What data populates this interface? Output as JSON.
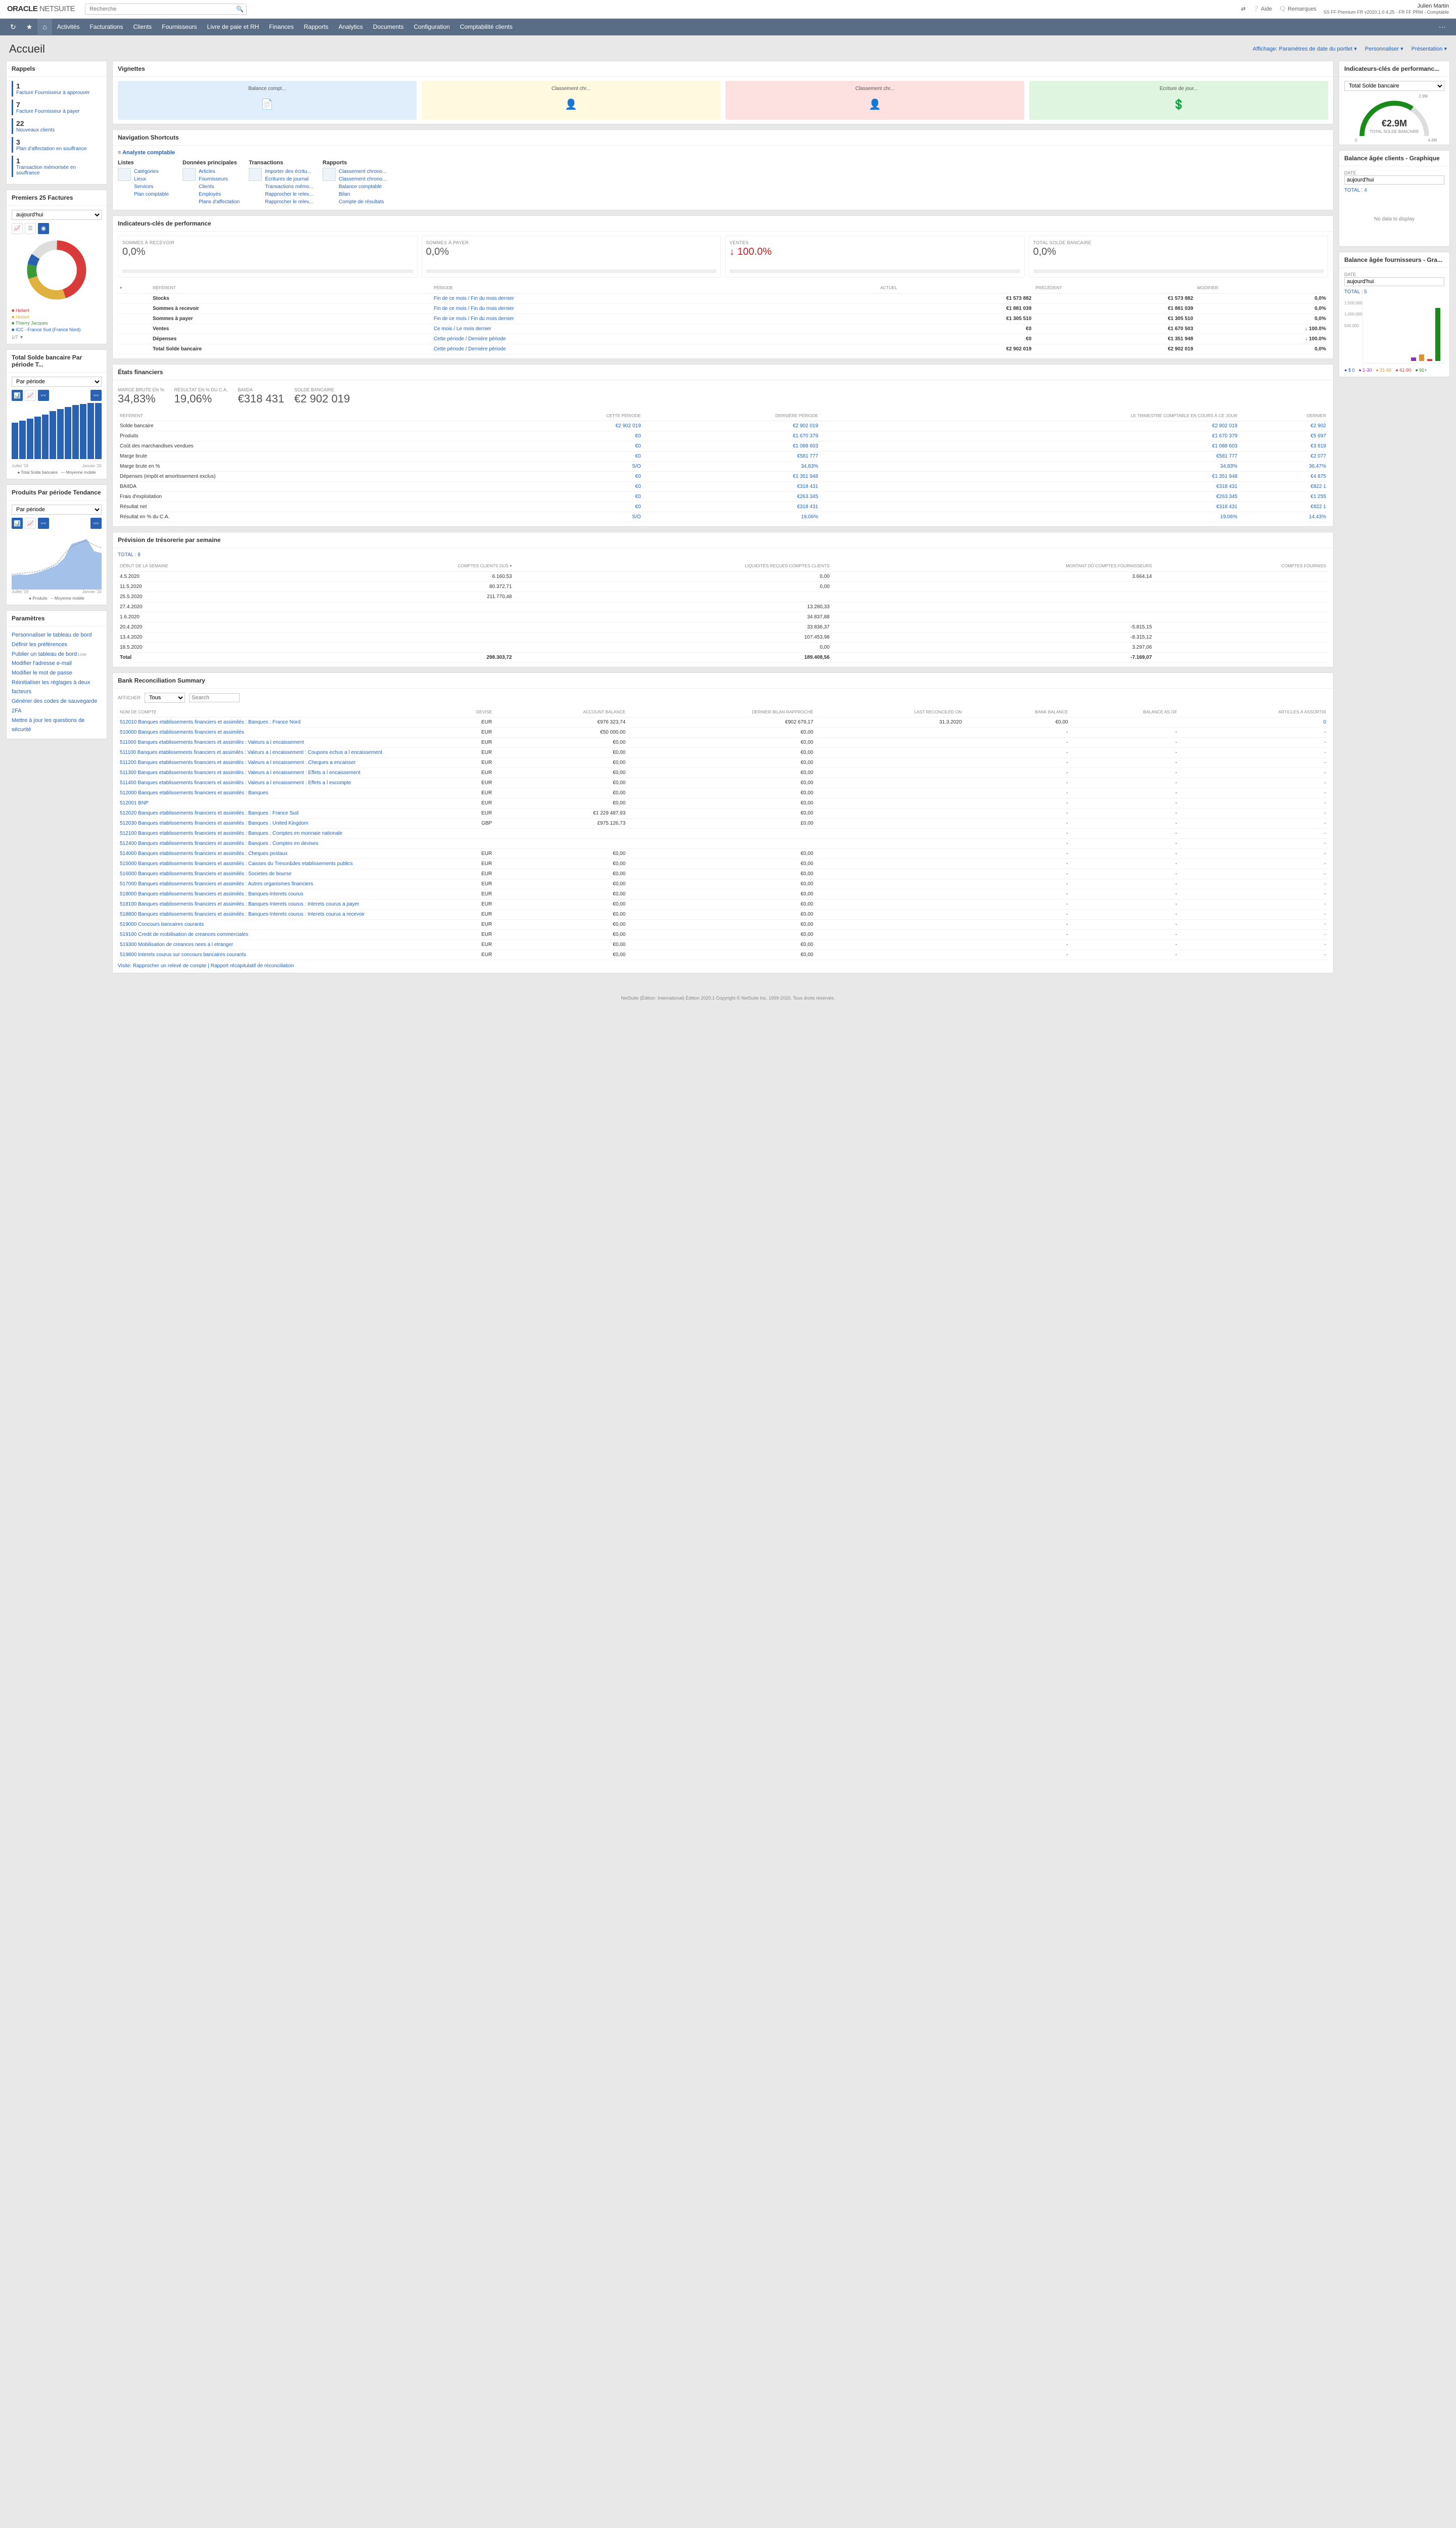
{
  "header": {
    "brand_a": "ORACLE",
    "brand_b": "NETSUITE",
    "search_placeholder": "Recherche",
    "help": "Aide",
    "remarks": "Remarques",
    "user_name": "Julien Martin",
    "user_sub": "SS FF Premium FR v2020.1.0 4.25 - FR FF PRM - Comptable"
  },
  "nav": [
    "Activités",
    "Facturations",
    "Clients",
    "Fournisseurs",
    "Livre de paie et RH",
    "Finances",
    "Rapports",
    "Analytics",
    "Documents",
    "Configuration",
    "Comptabilité clients"
  ],
  "page_title": "Accueil",
  "head_links": {
    "affichage": "Affichage: Paramètres de date du portlet",
    "personnaliser": "Personnaliser",
    "presentation": "Présentation"
  },
  "rappels": {
    "title": "Rappels",
    "items": [
      {
        "n": "1",
        "t": "Facture Fournisseur à approuver"
      },
      {
        "n": "7",
        "t": "Facture Fournisseur à payer"
      },
      {
        "n": "22",
        "t": "Nouveaux clients"
      },
      {
        "n": "3",
        "t": "Plan d'affectation en souffrance"
      },
      {
        "n": "1",
        "t": "Transaction mémorisée en souffrance"
      }
    ]
  },
  "p25f": {
    "title": "Premiers 25 Factures",
    "filter": "aujourd'hui",
    "legend": [
      "Hebert",
      "Hebert",
      "Thierry Jacques",
      "ICC - France Sud (France Nord)"
    ],
    "legend_colors": [
      "#d93a3a",
      "#e0b040",
      "#3a9a3a",
      "#2962b3"
    ],
    "pager": "1/7"
  },
  "tsb": {
    "title": "Total Solde bancaire Par période T...",
    "filter": "Par période",
    "chart_data": {
      "type": "bar+line",
      "x": [
        "Juillet '19",
        "",
        "",
        "",
        "",
        "",
        "Janvier '20",
        "",
        "",
        "",
        "",
        ""
      ],
      "bars": [
        1.9,
        2.0,
        2.1,
        2.2,
        2.3,
        2.5,
        2.6,
        2.7,
        2.8,
        2.85,
        2.9,
        2.9
      ],
      "line": [
        2.0,
        2.05,
        2.1,
        2.2,
        2.3,
        2.45,
        2.55,
        2.65,
        2.75,
        2.82,
        2.88,
        2.9
      ],
      "yticks": [
        "1.00M",
        "1.50M",
        "2.00M",
        "2.50M",
        "3.00M",
        "3.50M"
      ],
      "axis_labels": [
        "Juillet '19",
        "Janvier '20"
      ],
      "legend": [
        "Total Solde bancaire",
        "Moyenne mobile"
      ]
    }
  },
  "ppt": {
    "title": "Produits Par période Tendance",
    "filter": "Par période",
    "chart_data": {
      "type": "area+line",
      "x": [
        "Juillet '19",
        "",
        "",
        "",
        "",
        "",
        "Janvier '20",
        "",
        "",
        "",
        "",
        ""
      ],
      "area": [
        0.6,
        0.64,
        0.62,
        0.66,
        0.7,
        0.78,
        0.82,
        1.0,
        1.5,
        1.5,
        1.6,
        1.2
      ],
      "line": [
        0.62,
        0.65,
        0.67,
        0.7,
        0.73,
        0.8,
        0.88,
        1.2,
        1.4,
        1.5,
        1.55,
        1.4
      ],
      "yticks": [
        "1.00M",
        "2.00M"
      ],
      "axis_labels": [
        "Juillet '19",
        "Janvier '20"
      ],
      "legend": [
        "Produits",
        "Moyenne mobile"
      ]
    }
  },
  "params": {
    "title": "Paramètres",
    "links": [
      "Personnaliser le tableau de bord",
      "Définir les préférences",
      "Publier un tableau de bord",
      "Modifier l'adresse e-mail",
      "Modifier le mot de passe",
      "Réinitialiser les réglages à deux facteurs",
      "Générer des codes de sauvegarde 2FA",
      "Mettre à jour les questions de sécurité"
    ],
    "liste_tag": "Liste"
  },
  "vignettes": {
    "title": "Vignettes",
    "cards": [
      "Balance compt...",
      "Classement chr...",
      "Classement chr...",
      "Écriture de jour..."
    ]
  },
  "shortcuts": {
    "title": "Navigation Shortcuts",
    "role": "Analyste comptable",
    "cols": [
      {
        "h": "Listes",
        "items": [
          "Catégories",
          "Lieux",
          "Services",
          "Plan comptable"
        ]
      },
      {
        "h": "Données principales",
        "items": [
          "Articles",
          "Fournisseurs",
          "Clients",
          "Employés",
          "Plans d'affectation"
        ]
      },
      {
        "h": "Transactions",
        "items": [
          "Importer des écritu...",
          "Écritures de journal",
          "Transactions mémo...",
          "Rapprocher le relev...",
          "Rapprocher le relev..."
        ]
      },
      {
        "h": "Rapports",
        "items": [
          "Classement chrono...",
          "Classement chrono...",
          "Balance comptable",
          "Bilan",
          "Compte de résultats"
        ]
      }
    ]
  },
  "kpi": {
    "title": "Indicateurs-clés de performance",
    "panels": [
      {
        "lbl": "SOMMES À RECEVOIR",
        "val": "0,0%"
      },
      {
        "lbl": "SOMMES À PAYER",
        "val": "0,0%"
      },
      {
        "lbl": "VENTES",
        "val": "100.0%",
        "down": true
      },
      {
        "lbl": "TOTAL SOLDE BANCAIRE",
        "val": "0,0%"
      }
    ],
    "table_head": [
      "RÉFÉRENT",
      "PÉRIODE",
      "ACTUEL",
      "PRÉCÉDENT",
      "MODIFIER"
    ],
    "rows": [
      [
        "Stocks",
        "Fin de ce mois / Fin du mois dernier",
        "€1 573 882",
        "€1 573 882",
        "0,0%",
        ""
      ],
      [
        "Sommes à recevoir",
        "Fin de ce mois / Fin du mois dernier",
        "€1 881 039",
        "€1 881 039",
        "0,0%",
        ""
      ],
      [
        "Sommes à payer",
        "Fin de ce mois / Fin du mois dernier",
        "€1 305 510",
        "€1 305 510",
        "0,0%",
        ""
      ],
      [
        "Ventes",
        "Ce mois / Le mois dernier",
        "€0",
        "€1 670 503",
        "100.0%",
        "down"
      ],
      [
        "Dépenses",
        "Cette période / Dernière période",
        "€0",
        "€1 351 948",
        "100.0%",
        "up"
      ],
      [
        "Total Solde bancaire",
        "Cette période / Dernière période",
        "€2 902 019",
        "€2 902 019",
        "0,0%",
        ""
      ]
    ]
  },
  "etats": {
    "title": "États financiers",
    "summary": [
      {
        "lbl": "MARGE BRUTE EN %",
        "val": "34,83%"
      },
      {
        "lbl": "RÉSULTAT EN % DU C.A.",
        "val": "19,06%"
      },
      {
        "lbl": "BAIIDA",
        "val": "€318 431"
      },
      {
        "lbl": "SOLDE BANCAIRE",
        "val": "€2 902 019"
      }
    ],
    "thead": [
      "RÉFÉRENT",
      "CETTE PÉRIODE",
      "DERNIÈRE PÉRIODE",
      "LE TRIMESTRE COMPTABLE EN COURS À CE JOUR",
      "DERNIER"
    ],
    "rows": [
      [
        "Solde bancaire",
        "€2 902 019",
        "€2 902 019",
        "€2 902 019",
        "€2 902"
      ],
      [
        "Produits",
        "€0",
        "€1 670 379",
        "€1 670 379",
        "€5 697"
      ],
      [
        "Coût des marchandises vendues",
        "€0",
        "€1 088 603",
        "€1 088 603",
        "€3 619"
      ],
      [
        "Marge brute",
        "€0",
        "€581 777",
        "€581 777",
        "€2 077"
      ],
      [
        "Marge brute en %",
        "S/O",
        "34,83%",
        "34,83%",
        "36,47%"
      ],
      [
        "Dépenses (impôt et amortissement exclus)",
        "€0",
        "€1 351 948",
        "€1 351 948",
        "€4 875"
      ],
      [
        "BAIIDA",
        "€0",
        "€318 431",
        "€318 431",
        "€822 1"
      ],
      [
        "Frais d'exploitation",
        "€0",
        "€263 345",
        "€263 345",
        "€1 255"
      ],
      [
        "Résultat net",
        "€0",
        "€318 431",
        "€318 431",
        "€822 1"
      ],
      [
        "Résultat en % du C.A.",
        "S/O",
        "19,06%",
        "19,06%",
        "14,43%"
      ]
    ]
  },
  "prevision": {
    "title": "Prévision de trésorerie par semaine",
    "total": "TOTAL : 8",
    "thead": [
      "Début de la semaine",
      "Comptes clients dus ▾",
      "Liquidités reçues comptes clients",
      "Montant dû comptes fournisseurs",
      "Comptes fourniss"
    ],
    "rows": [
      [
        "4.5.2020",
        "6.160,53",
        "0,00",
        "3.664,14",
        ""
      ],
      [
        "11.5.2020",
        "80.372,71",
        "0,00",
        "",
        ""
      ],
      [
        "25.5.2020",
        "211.770,48",
        "",
        "",
        ""
      ],
      [
        "27.4.2020",
        "",
        "13.280,33",
        "",
        ""
      ],
      [
        "1.6.2020",
        "",
        "34.837,88",
        "",
        ""
      ],
      [
        "20.4.2020",
        "",
        "33.836,37",
        "-5.815,15",
        ""
      ],
      [
        "13.4.2020",
        "",
        "107.453,98",
        "-8.315,12",
        ""
      ],
      [
        "18.5.2020",
        "",
        "0,00",
        "3.297,06",
        ""
      ],
      [
        "Total",
        "298.303,72",
        "189.408,56",
        "-7.169,07",
        ""
      ]
    ]
  },
  "bank": {
    "title": "Bank Reconciliation Summary",
    "afficher_label": "AFFICHER",
    "afficher": "Tous",
    "search_ph": "Search",
    "thead": [
      "Nom de compte",
      "Devise",
      "Account Balance",
      "Dernier bilan rapproché",
      "Last Reconciled On",
      "Bank Balance",
      "Balance As Of",
      "Articles à assortir"
    ],
    "rows": [
      [
        "512010 Banques etablissements financiers et assimilés : Banques : France Nord",
        "EUR",
        "€976 323,74",
        "€902 679,17",
        "31.3.2020",
        "€0,00",
        "",
        "0"
      ],
      [
        "510000 Banques etablissements financiers et assimilés",
        "EUR",
        "€50 000,00",
        "€0,00",
        "",
        "-",
        "-",
        "-"
      ],
      [
        "511000 Banques etablissements financiers et assimilés : Valeurs a l encaissement",
        "EUR",
        "€0,00",
        "€0,00",
        "",
        "-",
        "-",
        "-"
      ],
      [
        "511100 Banques etablissements financiers et assimilés : Valeurs a l encaissement : Coupons echus a l encaissement",
        "EUR",
        "€0,00",
        "€0,00",
        "",
        "-",
        "-",
        "-"
      ],
      [
        "511200 Banques etablissements financiers et assimilés : Valeurs a l encaissement : Cheques a encaisser",
        "EUR",
        "€0,00",
        "€0,00",
        "",
        "-",
        "-",
        "-"
      ],
      [
        "511300 Banques etablissements financiers et assimilés : Valeurs a l encaissement : Effets a l encaissement",
        "EUR",
        "€0,00",
        "€0,00",
        "",
        "-",
        "-",
        "-"
      ],
      [
        "511400 Banques etablissements financiers et assimilés : Valeurs a l encaissement : Effets a l escompte",
        "EUR",
        "€0,00",
        "€0,00",
        "",
        "-",
        "-",
        "-"
      ],
      [
        "512000 Banques etablissements financiers et assimilés : Banques",
        "EUR",
        "€0,00",
        "€0,00",
        "",
        "-",
        "-",
        "-"
      ],
      [
        "512001 BNP",
        "EUR",
        "€0,00",
        "€0,00",
        "",
        "-",
        "-",
        "-"
      ],
      [
        "512020 Banques etablissements financiers et assimilés : Banques : France Sud",
        "EUR",
        "€1 229 487,93",
        "€0,00",
        "",
        "-",
        "-",
        "-"
      ],
      [
        "512030 Banques etablissements financiers et assimilés : Banques : United Kingdom",
        "GBP",
        "£975.126,73",
        "£0,00",
        "",
        "-",
        "-",
        "-"
      ],
      [
        "512100 Banques etablissements financiers et assimilés : Banques : Comptes en monnaie nationale",
        "",
        "",
        "",
        "",
        "-",
        "-",
        "-"
      ],
      [
        "512400 Banques etablissements financiers et assimilés : Banques : Comptes en devises",
        "",
        "",
        "",
        "",
        "-",
        "-",
        "-"
      ],
      [
        "514000 Banques etablissements financiers et assimilés : Cheques postaux",
        "EUR",
        "€0,00",
        "€0,00",
        "",
        "-",
        "-",
        "-"
      ],
      [
        "515000 Banques etablissements financiers et assimilés : Caisses du Tresor&des etablissements publics",
        "EUR",
        "€0,00",
        "€0,00",
        "",
        "-",
        "-",
        "-"
      ],
      [
        "516000 Banques etablissements financiers et assimilés : Societes de bourse",
        "EUR",
        "€0,00",
        "€0,00",
        "",
        "-",
        "-",
        "-"
      ],
      [
        "517000 Banques etablissements financiers et assimilés : Autres organismes financiers",
        "EUR",
        "€0,00",
        "€0,00",
        "",
        "-",
        "-",
        "-"
      ],
      [
        "518000 Banques etablissements financiers et assimilés : Banques-Interets courus",
        "EUR",
        "€0,00",
        "€0,00",
        "",
        "-",
        "-",
        "-"
      ],
      [
        "518100 Banques etablissements financiers et assimilés : Banques-Interets courus : Interets courus a payer",
        "EUR",
        "€0,00",
        "€0,00",
        "",
        "-",
        "-",
        "-"
      ],
      [
        "518800 Banques etablissements financiers et assimilés : Banques-Interets courus : Interets courus a recevoir",
        "EUR",
        "€0,00",
        "€0,00",
        "",
        "-",
        "-",
        "-"
      ],
      [
        "519000 Concours bancaires courants",
        "EUR",
        "€0,00",
        "€0,00",
        "",
        "-",
        "-",
        "-"
      ],
      [
        "519100 Credit de mobilisation de creances commerciales",
        "EUR",
        "€0,00",
        "€0,00",
        "",
        "-",
        "-",
        "-"
      ],
      [
        "519300 Mobilisation de creances nees a l etranger",
        "EUR",
        "€0,00",
        "€0,00",
        "",
        "-",
        "-",
        "-"
      ],
      [
        "519800 Interets courus sur concours bancaires courants",
        "EUR",
        "€0,00",
        "€0,00",
        "",
        "-",
        "-",
        "-"
      ]
    ],
    "visite": "Visite: Rapprocher un relevé de compte | Rapport récapitulatif de réconciliation"
  },
  "gauge": {
    "title": "Indicateurs-clés de performanc...",
    "filter": "Total Solde bancaire",
    "value": "€2.9M",
    "label": "TOTAL SOLDE BANCAIRE",
    "min_label": "0",
    "mid_label": "2.9M",
    "max_label": "4.4M"
  },
  "agee_clients": {
    "title": "Balance âgée clients - Graphique",
    "date_label": "DATE",
    "date": "aujourd'hui",
    "total": "TOTAL : 4",
    "nodata": "No data to display"
  },
  "agee_fourn": {
    "title": "Balance âgée fournisseurs - Gra...",
    "date_label": "DATE",
    "date": "aujourd'hui",
    "total": "TOTAL : 5",
    "chart_data": {
      "type": "bar",
      "categories": [
        "$ 0",
        "1-30",
        "31-60",
        "61-90",
        "91+"
      ],
      "values": [
        0,
        100000,
        180000,
        -60000,
        1450000
      ],
      "colors": [
        "#2962b3",
        "#8a32c0",
        "#e09030",
        "#d93a3a",
        "#1a8a1a"
      ],
      "yticks": [
        "500,000",
        "1,000,000",
        "1,500,000"
      ]
    },
    "legend": [
      "$ 0",
      "1-30",
      "31-60",
      "61-90",
      "91+"
    ]
  },
  "footer": "NetSuite (Édition :International) Édition 2020.1 Copyright © NetSuite Inc. 1999-2020. Tous droits réservés."
}
